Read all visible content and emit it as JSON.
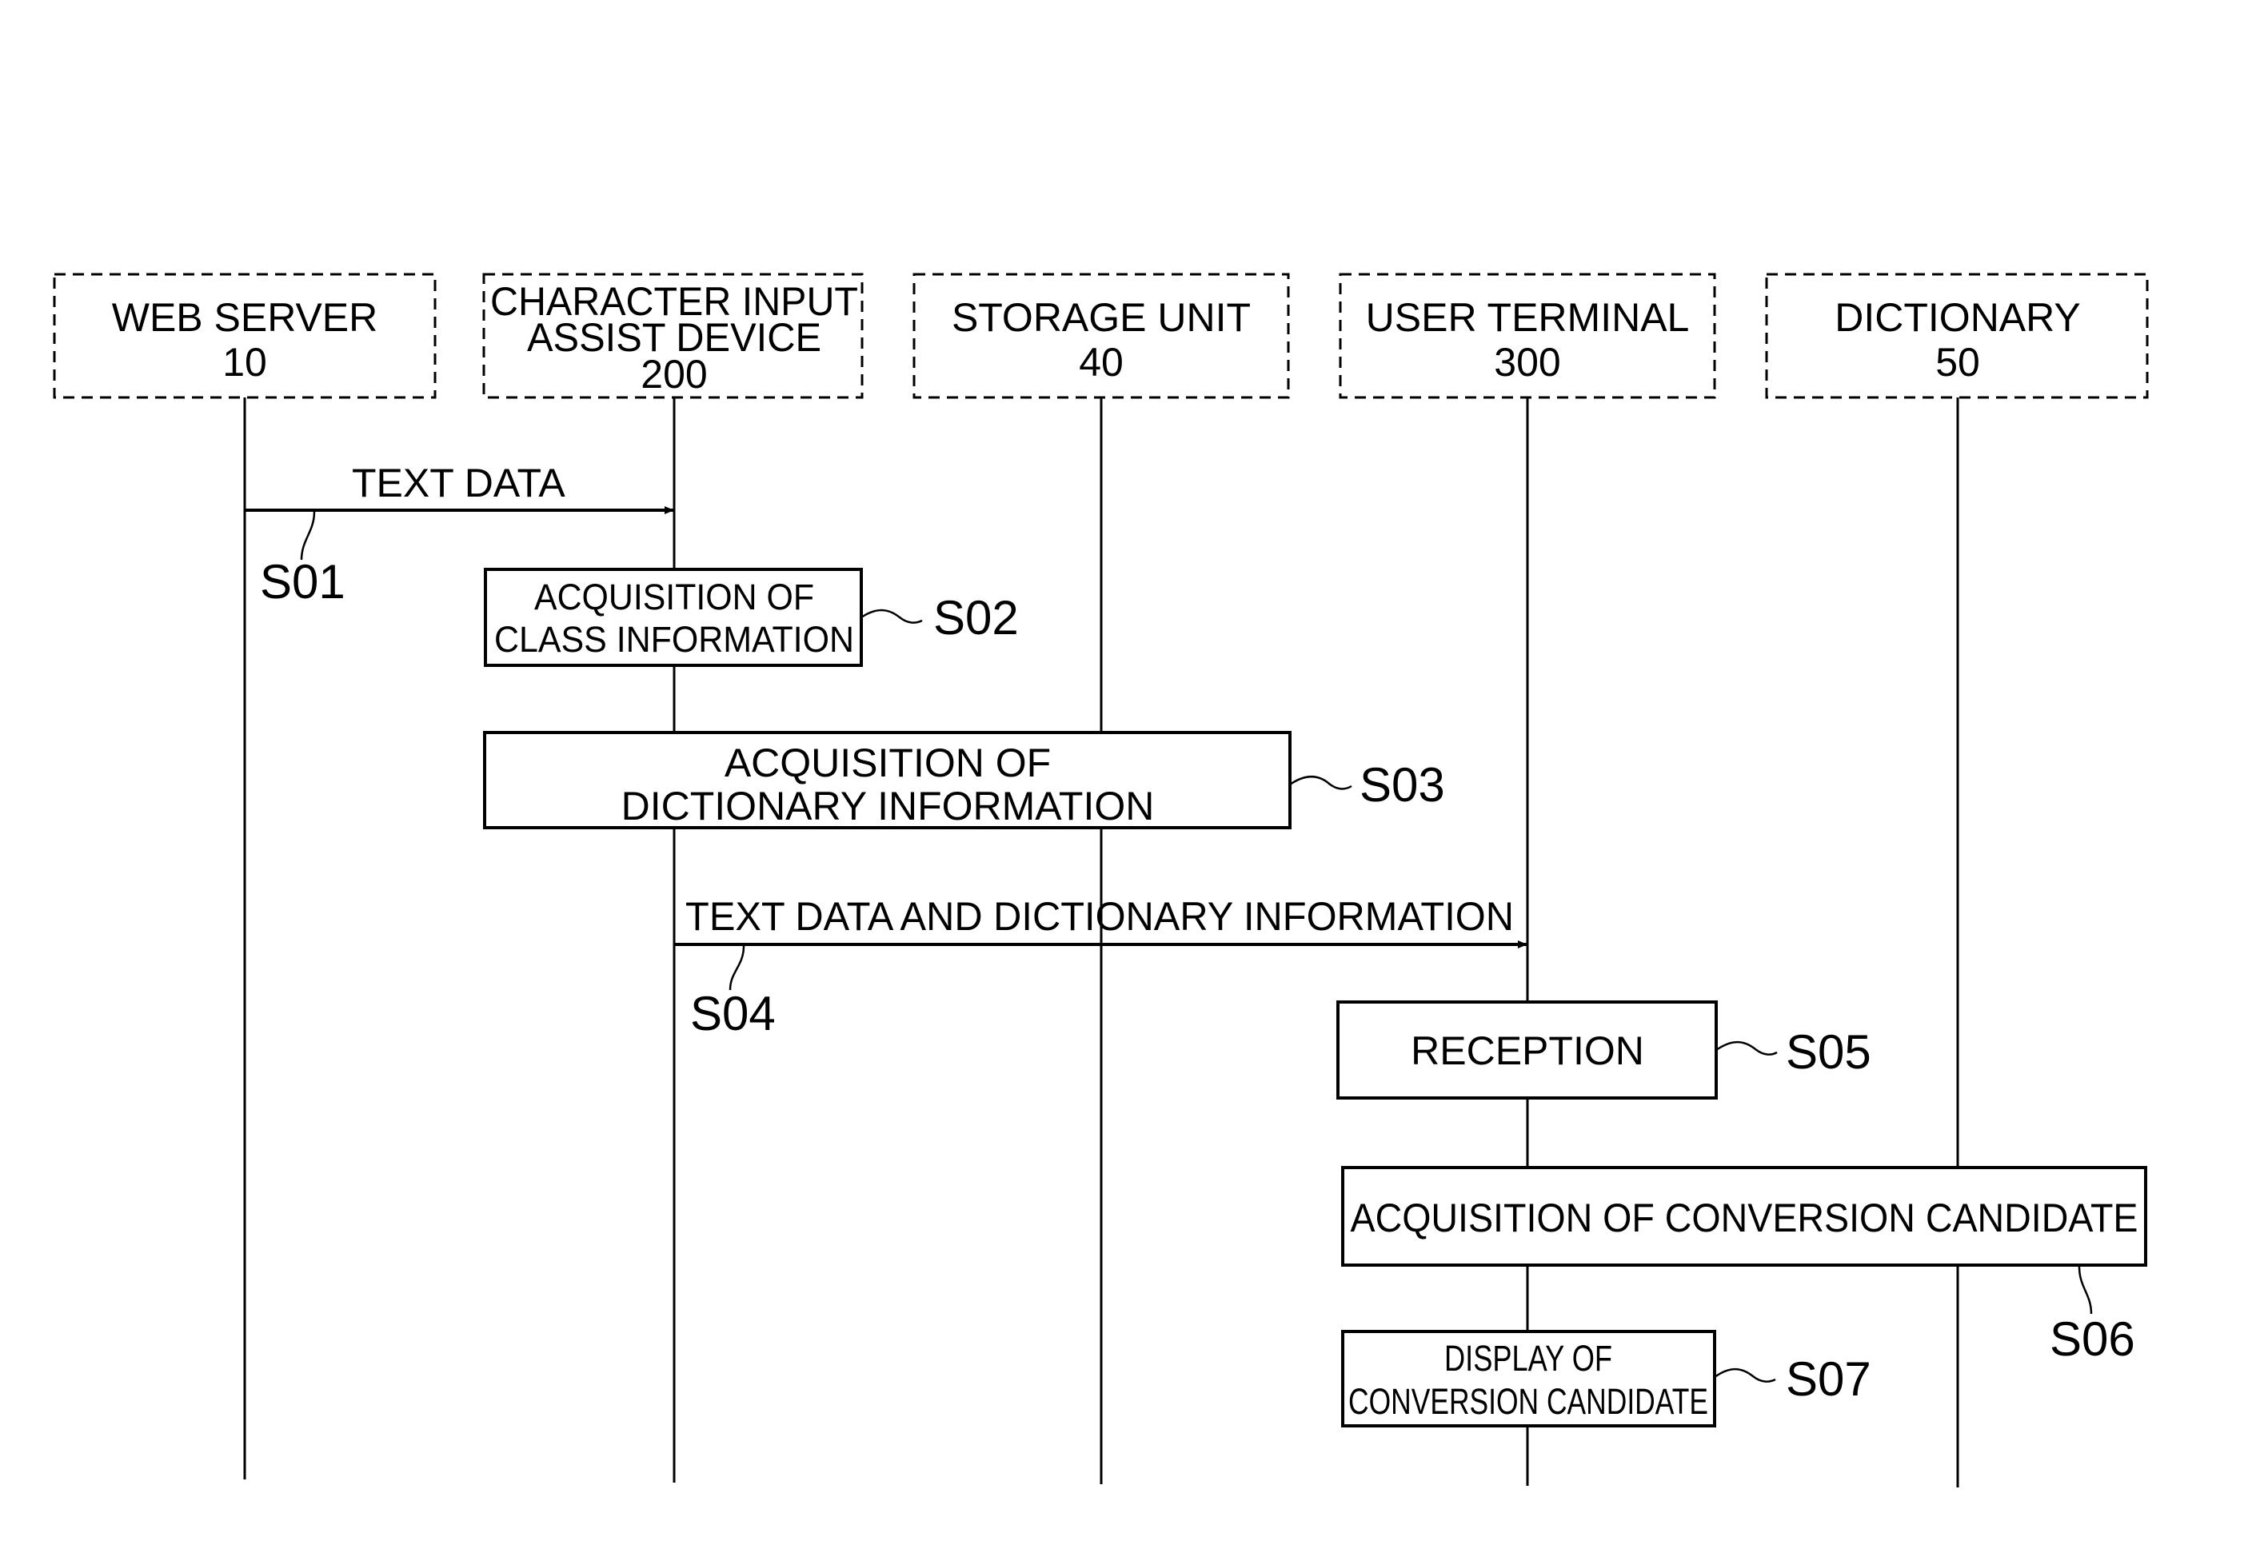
{
  "diagram": {
    "type": "sequence-diagram",
    "colors": {
      "ink": "#000000",
      "background": "#ffffff"
    },
    "participants": [
      {
        "id": "web_server",
        "name": "WEB SERVER",
        "ref": "10",
        "lines": [
          "WEB SERVER",
          "10"
        ]
      },
      {
        "id": "assist_device",
        "name": "CHARACTER INPUT ASSIST DEVICE",
        "ref": "200",
        "lines": [
          "CHARACTER INPUT",
          "ASSIST DEVICE",
          "200"
        ]
      },
      {
        "id": "storage_unit",
        "name": "STORAGE UNIT",
        "ref": "40",
        "lines": [
          "STORAGE UNIT",
          "40"
        ]
      },
      {
        "id": "user_terminal",
        "name": "USER TERMINAL",
        "ref": "300",
        "lines": [
          "USER TERMINAL",
          "300"
        ]
      },
      {
        "id": "dictionary",
        "name": "DICTIONARY",
        "ref": "50",
        "lines": [
          "DICTIONARY",
          "50"
        ]
      }
    ],
    "steps": [
      {
        "id": "S01",
        "kind": "message",
        "from": "web_server",
        "to": "assist_device",
        "label": "TEXT DATA"
      },
      {
        "id": "S02",
        "kind": "process",
        "lines": [
          "ACQUISITION OF",
          "CLASS INFORMATION"
        ],
        "spans": [
          "assist_device"
        ]
      },
      {
        "id": "S03",
        "kind": "process",
        "lines": [
          "ACQUISITION OF",
          "DICTIONARY INFORMATION"
        ],
        "spans": [
          "assist_device",
          "storage_unit"
        ]
      },
      {
        "id": "S04",
        "kind": "message",
        "from": "assist_device",
        "to": "user_terminal",
        "label": "TEXT DATA AND DICTIONARY INFORMATION"
      },
      {
        "id": "S05",
        "kind": "process",
        "lines": [
          "RECEPTION"
        ],
        "spans": [
          "user_terminal"
        ]
      },
      {
        "id": "S06",
        "kind": "process",
        "lines": [
          "ACQUISITION OF CONVERSION CANDIDATE"
        ],
        "spans": [
          "user_terminal",
          "dictionary"
        ]
      },
      {
        "id": "S07",
        "kind": "process",
        "lines": [
          "DISPLAY OF",
          "CONVERSION CANDIDATE"
        ],
        "spans": [
          "user_terminal"
        ]
      }
    ]
  }
}
